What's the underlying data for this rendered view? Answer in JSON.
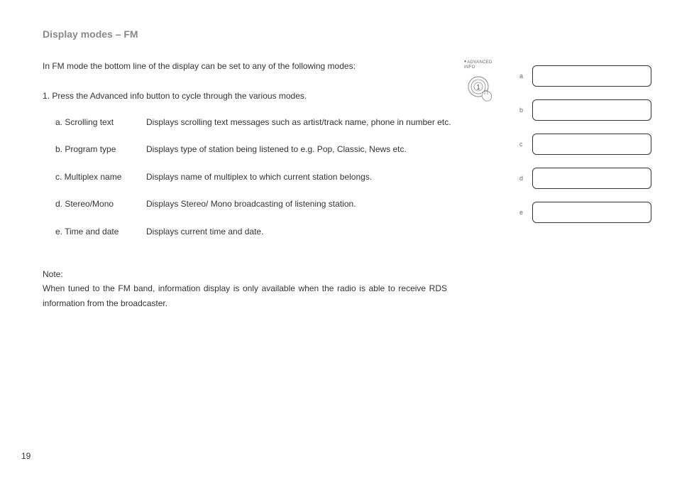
{
  "title": "Display modes – FM",
  "intro": "In FM mode the bottom line of the display can be set to any of the following modes:",
  "step1": "1. Press the Advanced info button to cycle through the various modes.",
  "modes": [
    {
      "label": "a. Scrolling text",
      "desc": "Displays scrolling text messages such as artist/track name, phone in number etc."
    },
    {
      "label": "b. Program type",
      "desc": "Displays type of station being listened to e.g. Pop, Classic, News etc."
    },
    {
      "label": "c. Multiplex name",
      "desc": "Displays name of multiplex to which current station belongs."
    },
    {
      "label": "d. Stereo/Mono",
      "desc": "Displays Stereo/ Mono broadcasting of listening station."
    },
    {
      "label": "e. Time and date",
      "desc": "Displays current time and date."
    }
  ],
  "note_label": "Note:",
  "note_text": "When tuned to the FM band, information display is only available when the radio is able to receive RDS information from the broadcaster.",
  "button_label_line1": "ADVANCED",
  "button_label_line2": "INFO",
  "button_number": "1",
  "display_letters": [
    "a",
    "b",
    "c",
    "d",
    "e"
  ],
  "page_number": "19"
}
